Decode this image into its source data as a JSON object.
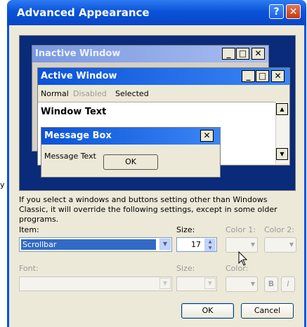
{
  "background_text": {
    "left_char": "y"
  },
  "dialog": {
    "title": "Advanced Appearance",
    "help_glyph": "?",
    "close_glyph": "✕"
  },
  "preview": {
    "inactive_window_title": "Inactive Window",
    "active_window_title": "Active Window",
    "menu_normal": "Normal",
    "menu_disabled": "Disabled",
    "menu_selected": "Selected",
    "window_text": "Window Text",
    "message_box_title": "Message Box",
    "message_text": "Message Text",
    "ok_label": "OK",
    "minimize_glyph": "_",
    "maximize_glyph": "□",
    "close_glyph": "✕",
    "scroll_up_glyph": "▲",
    "scroll_down_glyph": "▼"
  },
  "info_text": "If you select a windows and buttons setting other than Windows Classic, it will override the following settings, except in some older programs.",
  "item": {
    "label": "Item:",
    "value": "Scrollbar"
  },
  "size": {
    "label": "Size:",
    "value": "17"
  },
  "color1": {
    "label": "Color 1:"
  },
  "color2": {
    "label": "Color 2:"
  },
  "font": {
    "label": "Font:",
    "size_label": "Size:",
    "color_label": "Color:",
    "bold_label": "B",
    "italic_label": "I"
  },
  "buttons": {
    "ok": "OK",
    "cancel": "Cancel"
  },
  "colors": {
    "title_blue": "#0a53d9",
    "inactive_title": "#7b98e0",
    "preview_background": "#0a2a7a",
    "selection": "#316ac5",
    "dialog_face": "#ece9d8"
  }
}
